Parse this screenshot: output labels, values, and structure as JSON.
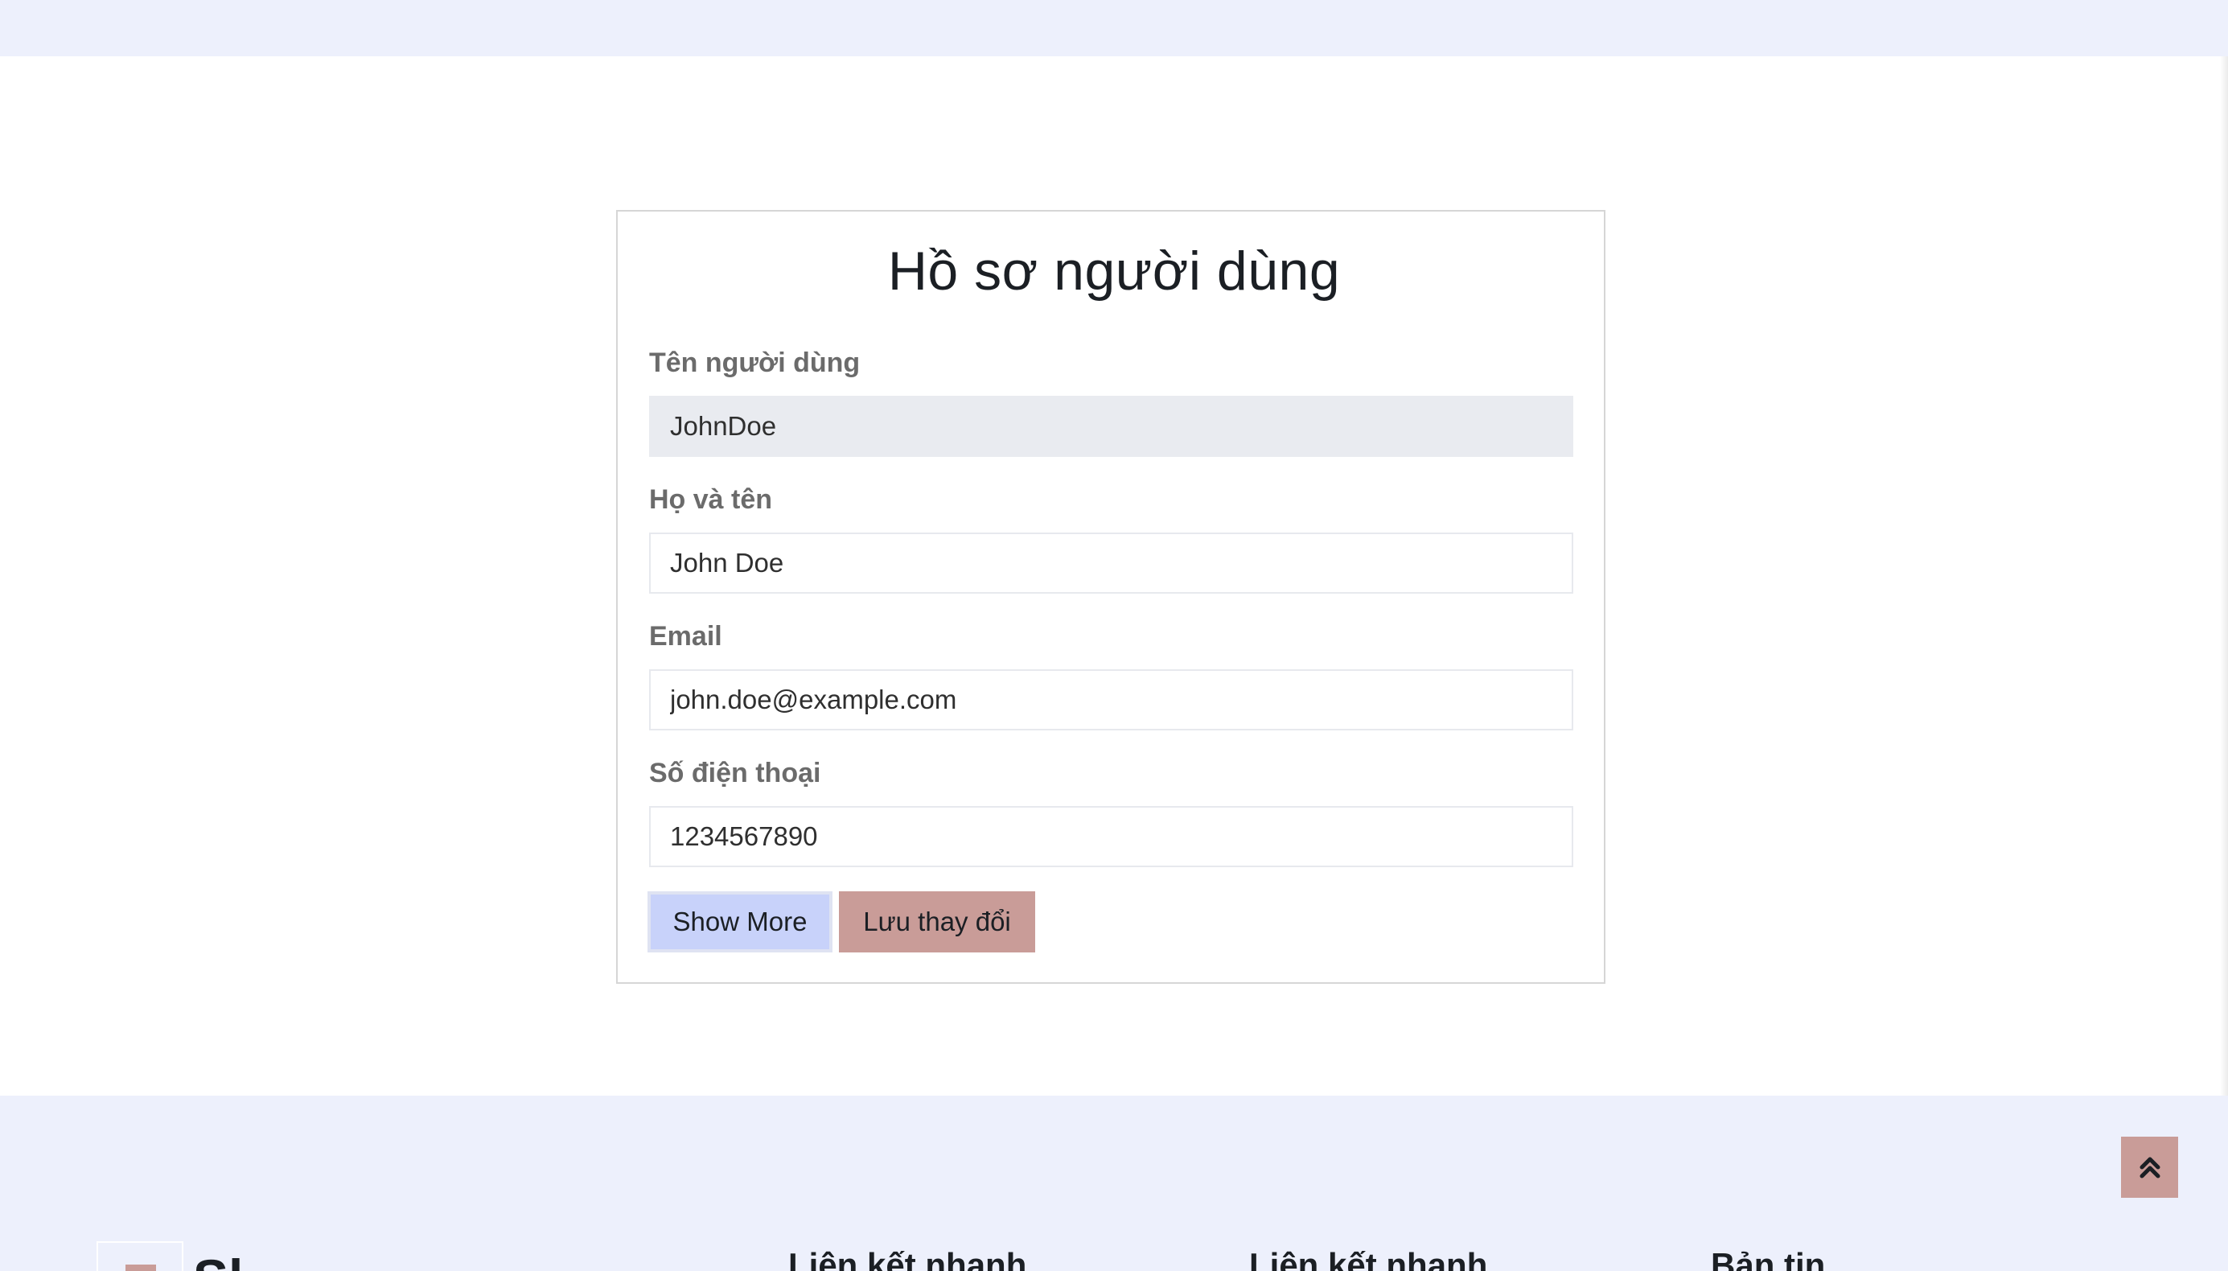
{
  "profile": {
    "title": "Hồ sơ người dùng",
    "fields": [
      {
        "label": "Tên người dùng",
        "value": "JohnDoe"
      },
      {
        "label": "Họ và tên",
        "value": "John Doe"
      },
      {
        "label": "Email",
        "value": "john.doe@example.com"
      },
      {
        "label": "Số điện thoại",
        "value": "1234567890"
      }
    ],
    "buttons": {
      "show_more": "Show More",
      "save": "Lưu thay đổi"
    }
  },
  "footer": {
    "logo_text": "Sl",
    "headings": [
      "Liên kết nhanh",
      "Liên kết nhanh",
      "Bản tin"
    ]
  },
  "colors": {
    "band_bg": "#edf0fc",
    "save_button": "#c99c98",
    "show_more_button": "#c8d2fa"
  },
  "icons": {
    "back_to_top": "double-chevron-up-icon"
  }
}
